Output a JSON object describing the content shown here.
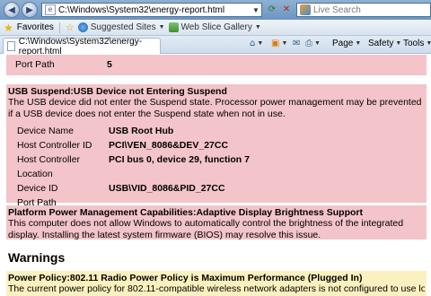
{
  "browser": {
    "address": "C:\\Windows\\System32\\energy-report.html",
    "search_placeholder": "Live Search",
    "favorites_label": "Favorites",
    "favorites_items": [
      {
        "label": "Suggested Sites",
        "icon": "ie-icon"
      },
      {
        "label": "Web Slice Gallery",
        "icon": "web-slice-icon"
      }
    ],
    "tab_title": "C:\\Windows\\System32\\energy-report.html",
    "commands": {
      "page": "Page",
      "safety": "Safety",
      "tools": "Tools"
    }
  },
  "report": {
    "partial": {
      "key": "Port Path",
      "value": "5"
    },
    "usb": {
      "title": "USB Suspend:USB Device not Entering Suspend",
      "desc": "The USB device did not enter the Suspend state. Processor power management may be prevented if a USB device does not enter the Suspend state when not in use.",
      "rows": [
        {
          "key": "Device Name",
          "value": "USB Root Hub"
        },
        {
          "key": "Host Controller ID",
          "value": "PCI\\VEN_8086&DEV_27CC"
        },
        {
          "key": "Host Controller Location",
          "value": "PCI bus 0, device 29, function 7"
        },
        {
          "key": "Device ID",
          "value": "USB\\VID_8086&PID_27CC"
        },
        {
          "key": "Port Path",
          "value": ""
        }
      ]
    },
    "platform": {
      "title": "Platform Power Management Capabilities:Adaptive Display Brightness Support",
      "desc": "This computer does not allow Windows to automatically control the brightness of the integrated display. Installing the latest system firmware (BIOS) may resolve this issue."
    },
    "warnings_heading": "Warnings",
    "warning": {
      "title": "Power Policy:802.11 Radio Power Policy is Maximum Performance (Plugged In)",
      "desc": "The current power policy for 802.11-compatible wireless network adapters is not configured to use low-"
    }
  }
}
